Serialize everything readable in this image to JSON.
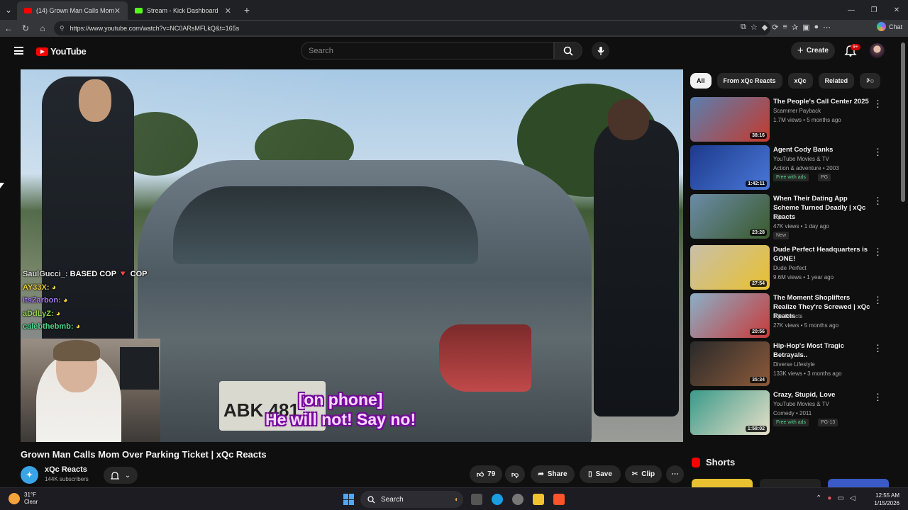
{
  "browser": {
    "tabs": [
      {
        "title": "(14) Grown Man Calls Mom O",
        "active": true,
        "favicon_color": "#ff0000"
      },
      {
        "title": "Stream - Kick Dashboard",
        "active": false,
        "favicon_color": "#53fc18"
      }
    ],
    "url": "https://www.youtube.com/watch?v=NC0ARsMFLkQ&t=165s",
    "chat_label": "Chat"
  },
  "youtube": {
    "logo_text": "YouTube",
    "search_placeholder": "Search",
    "create_label": "Create",
    "notif_badge": "9+"
  },
  "video": {
    "title": "Grown Man Calls Mom Over Parking Ticket | xQc Reacts",
    "caption_line1": "[on phone]",
    "caption_line2": "He will not! Say no!",
    "plate_text": "ABK 481",
    "channel_name": "xQc Reacts",
    "subscribers": "144K subscribers",
    "likes": "79",
    "share_label": "Share",
    "save_label": "Save",
    "clip_label": "Clip",
    "chat": [
      {
        "user": "SaulGucci_:",
        "msg": "BASED COP 🔻 COP"
      },
      {
        "user": "AY33X:",
        "msg": ""
      },
      {
        "user": "ItsZarbon:",
        "msg": ""
      },
      {
        "user": "aDdLyZ:",
        "msg": ""
      },
      {
        "user": "calebthebmb:",
        "msg": ""
      }
    ]
  },
  "sidebar": {
    "chips": [
      "All",
      "From xQc Reacts",
      "xQc",
      "Related",
      "Fo"
    ],
    "recommendations": [
      {
        "title": "The People's Call Center 2025",
        "channel": "Scammer Payback",
        "meta": "1.7M views • 5 months ago",
        "duration": "38:16",
        "extra": "",
        "tag": "",
        "colors": [
          "#5a7fb0",
          "#c43a2e"
        ]
      },
      {
        "title": "Agent Cody Banks",
        "channel": "YouTube Movies & TV",
        "meta": "Action & adventure • 2003",
        "duration": "1:42:11",
        "extra": "Free with ads",
        "tag": "PG",
        "colors": [
          "#1c3a8c",
          "#4a78d8"
        ]
      },
      {
        "title": "When Their Dating App Scheme Turned Deadly | xQc Reacts",
        "channel": "xQc",
        "meta": "47K views • 1 day ago",
        "duration": "23:28",
        "extra": "",
        "tag": "New",
        "colors": [
          "#6a8ca8",
          "#3b5a2c"
        ]
      },
      {
        "title": "Dude Perfect Headquarters is GONE!",
        "channel": "Dude Perfect",
        "meta": "9.6M views • 1 year ago",
        "duration": "27:54",
        "extra": "",
        "tag": "",
        "colors": [
          "#c9c0a8",
          "#e8c030"
        ]
      },
      {
        "title": "The Moment Shoplifters Realize They're Screwed | xQc Reacts",
        "channel": "xQc Reacts",
        "meta": "27K views • 5 months ago",
        "duration": "20:56",
        "extra": "",
        "tag": "",
        "colors": [
          "#8ab0c8",
          "#c83a3a"
        ]
      },
      {
        "title": "Hip-Hop's Most Tragic Betrayals..",
        "channel": "Diverse Lifestyle",
        "meta": "133K views • 3 months ago",
        "duration": "35:34",
        "extra": "",
        "tag": "",
        "colors": [
          "#2a2a2a",
          "#8c5a3a"
        ]
      },
      {
        "title": "Crazy, Stupid, Love",
        "channel": "YouTube Movies & TV",
        "meta": "Comedy • 2011",
        "duration": "1:58:02",
        "extra": "Free with ads",
        "tag": "PG-13",
        "colors": [
          "#3a9a8a",
          "#e8e0c8"
        ]
      }
    ],
    "shorts_label": "Shorts"
  },
  "taskbar": {
    "temp": "31°F",
    "condition": "Clear",
    "search_label": "Search",
    "time": "12:55 AM",
    "date": "1/15/2026"
  }
}
